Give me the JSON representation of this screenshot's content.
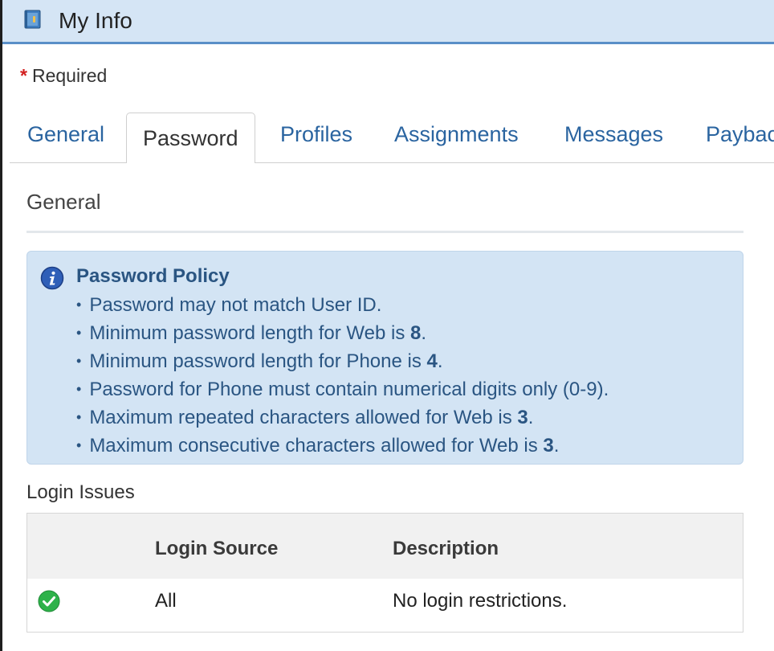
{
  "window": {
    "title": "My Info",
    "icon": "address-book-icon"
  },
  "form": {
    "required_marker": "*",
    "required_label": "Required"
  },
  "tabs": [
    {
      "label": "General",
      "active": false
    },
    {
      "label": "Password",
      "active": true
    },
    {
      "label": "Profiles",
      "active": false
    },
    {
      "label": "Assignments",
      "active": false
    },
    {
      "label": "Messages",
      "active": false
    },
    {
      "label": "Paybac",
      "active": false
    }
  ],
  "section": {
    "title": "General"
  },
  "policy": {
    "icon": "info-icon",
    "title": "Password Policy",
    "rules": [
      {
        "text": "Password may not match User ID.",
        "value": "",
        "suffix": ""
      },
      {
        "text": "Minimum password length for Web is ",
        "value": "8",
        "suffix": "."
      },
      {
        "text": "Minimum password length for Phone is ",
        "value": "4",
        "suffix": "."
      },
      {
        "text": "Password for Phone must contain numerical digits only (0-9).",
        "value": "",
        "suffix": ""
      },
      {
        "text": "Maximum repeated characters allowed for Web is ",
        "value": "3",
        "suffix": "."
      },
      {
        "text": "Maximum consecutive characters allowed for Web is ",
        "value": "3",
        "suffix": "."
      }
    ]
  },
  "login_issues": {
    "title": "Login Issues",
    "columns": [
      "Login Source",
      "Description"
    ],
    "rows": [
      {
        "status_icon": "green-check-icon",
        "source": "All",
        "description": "No login restrictions."
      }
    ]
  },
  "colors": {
    "titlebar_bg": "#d5e5f5",
    "titlebar_border": "#5a8fc8",
    "tab_link": "#2a64a0",
    "required_star": "#d21f1f",
    "policy_bg": "#d3e4f4",
    "policy_text": "#2a5582",
    "success_green": "#2eb24a"
  }
}
